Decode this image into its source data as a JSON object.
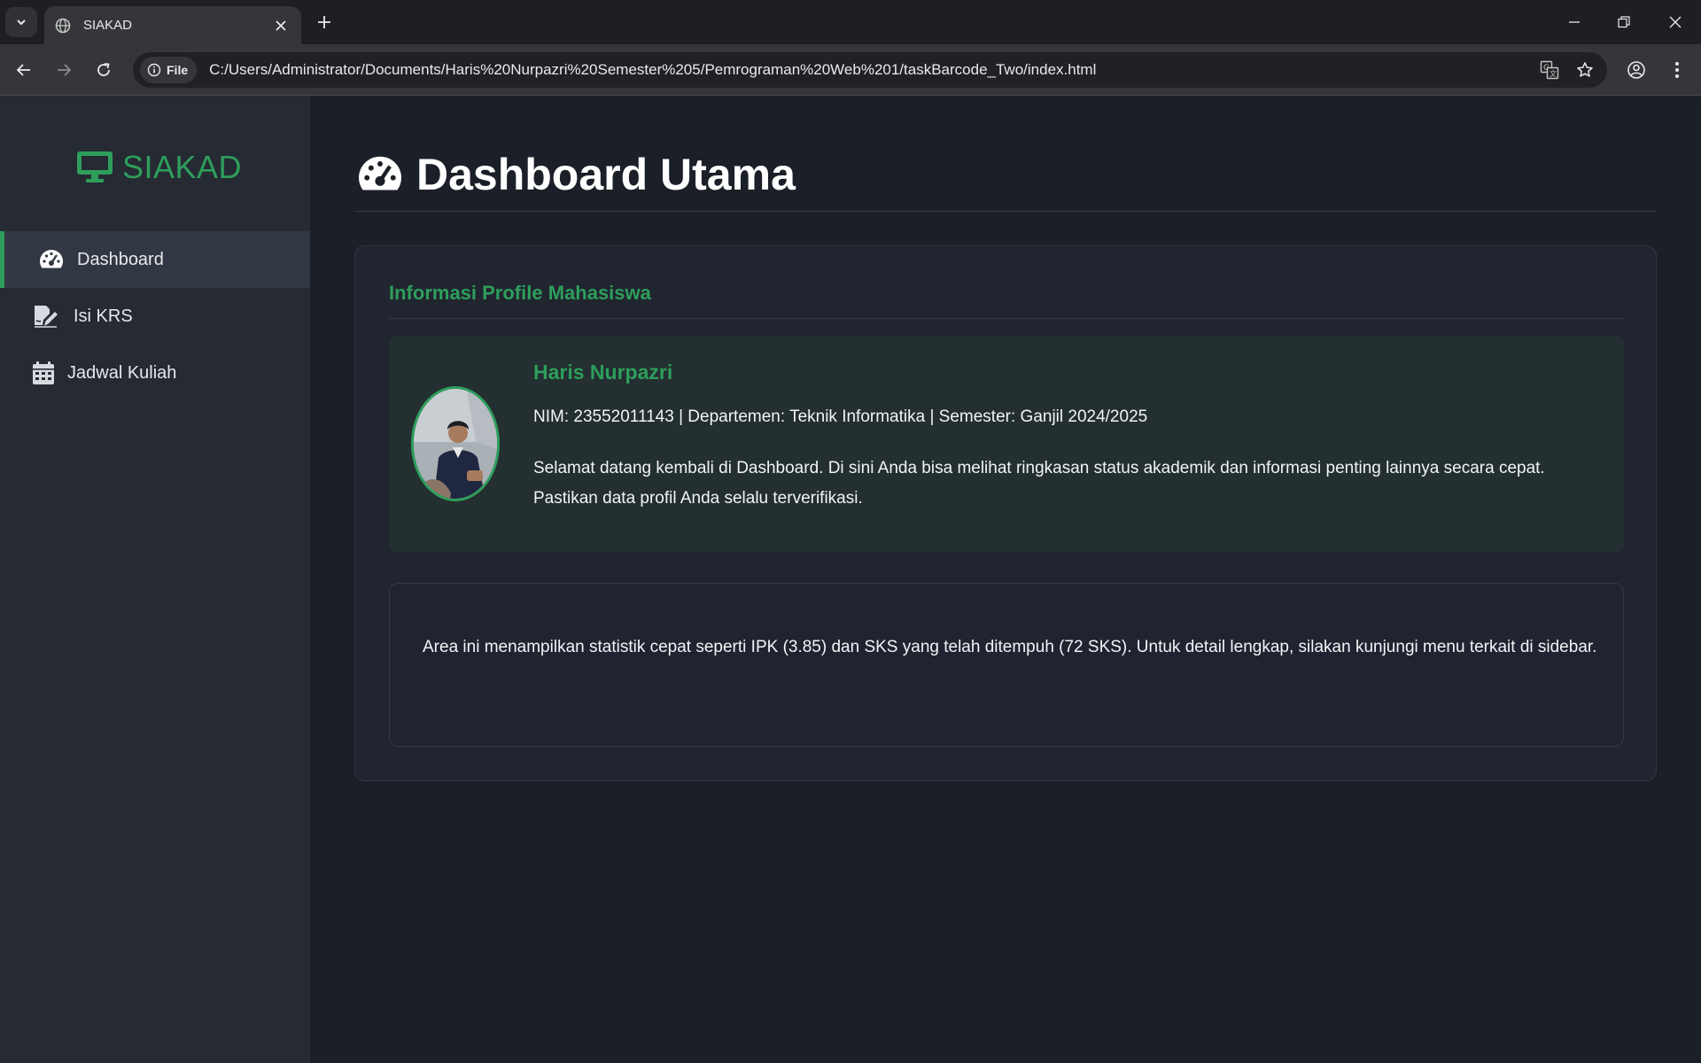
{
  "browser": {
    "tab_title": "SIAKAD",
    "chip_label": "File",
    "url": "C:/Users/Administrator/Documents/Haris%20Nurpazri%20Semester%205/Pemrograman%20Web%201/taskBarcode_Two/index.html"
  },
  "sidebar": {
    "brand": "SIAKAD",
    "items": [
      {
        "label": "Dashboard",
        "icon": "gauge-icon",
        "active": true
      },
      {
        "label": "Isi KRS",
        "icon": "file-signature-icon",
        "active": false
      },
      {
        "label": "Jadwal Kuliah",
        "icon": "calendar-icon",
        "active": false
      }
    ]
  },
  "main": {
    "title": "Dashboard Utama",
    "card_heading": "Informasi Profile Mahasiswa",
    "profile": {
      "name": "Haris Nurpazri",
      "meta": "NIM: 23552011143 | Departemen: Teknik Informatika | Semester: Ganjil 2024/2025",
      "welcome": "Selamat datang kembali di Dashboard. Di sini Anda bisa melihat ringkasan status akademik dan informasi penting lainnya secara cepat. Pastikan data profil Anda selalu terverifikasi."
    },
    "stats_text": "Area ini menampilkan statistik cepat seperti IPK (3.85) dan SKS yang telah ditempuh (72 SKS). Untuk detail lengkap, silakan kunjungi menu terkait di sidebar."
  },
  "colors": {
    "accent": "#2e9e5b",
    "sidebar_bg": "#252a33",
    "page_bg": "#1b1f27"
  }
}
